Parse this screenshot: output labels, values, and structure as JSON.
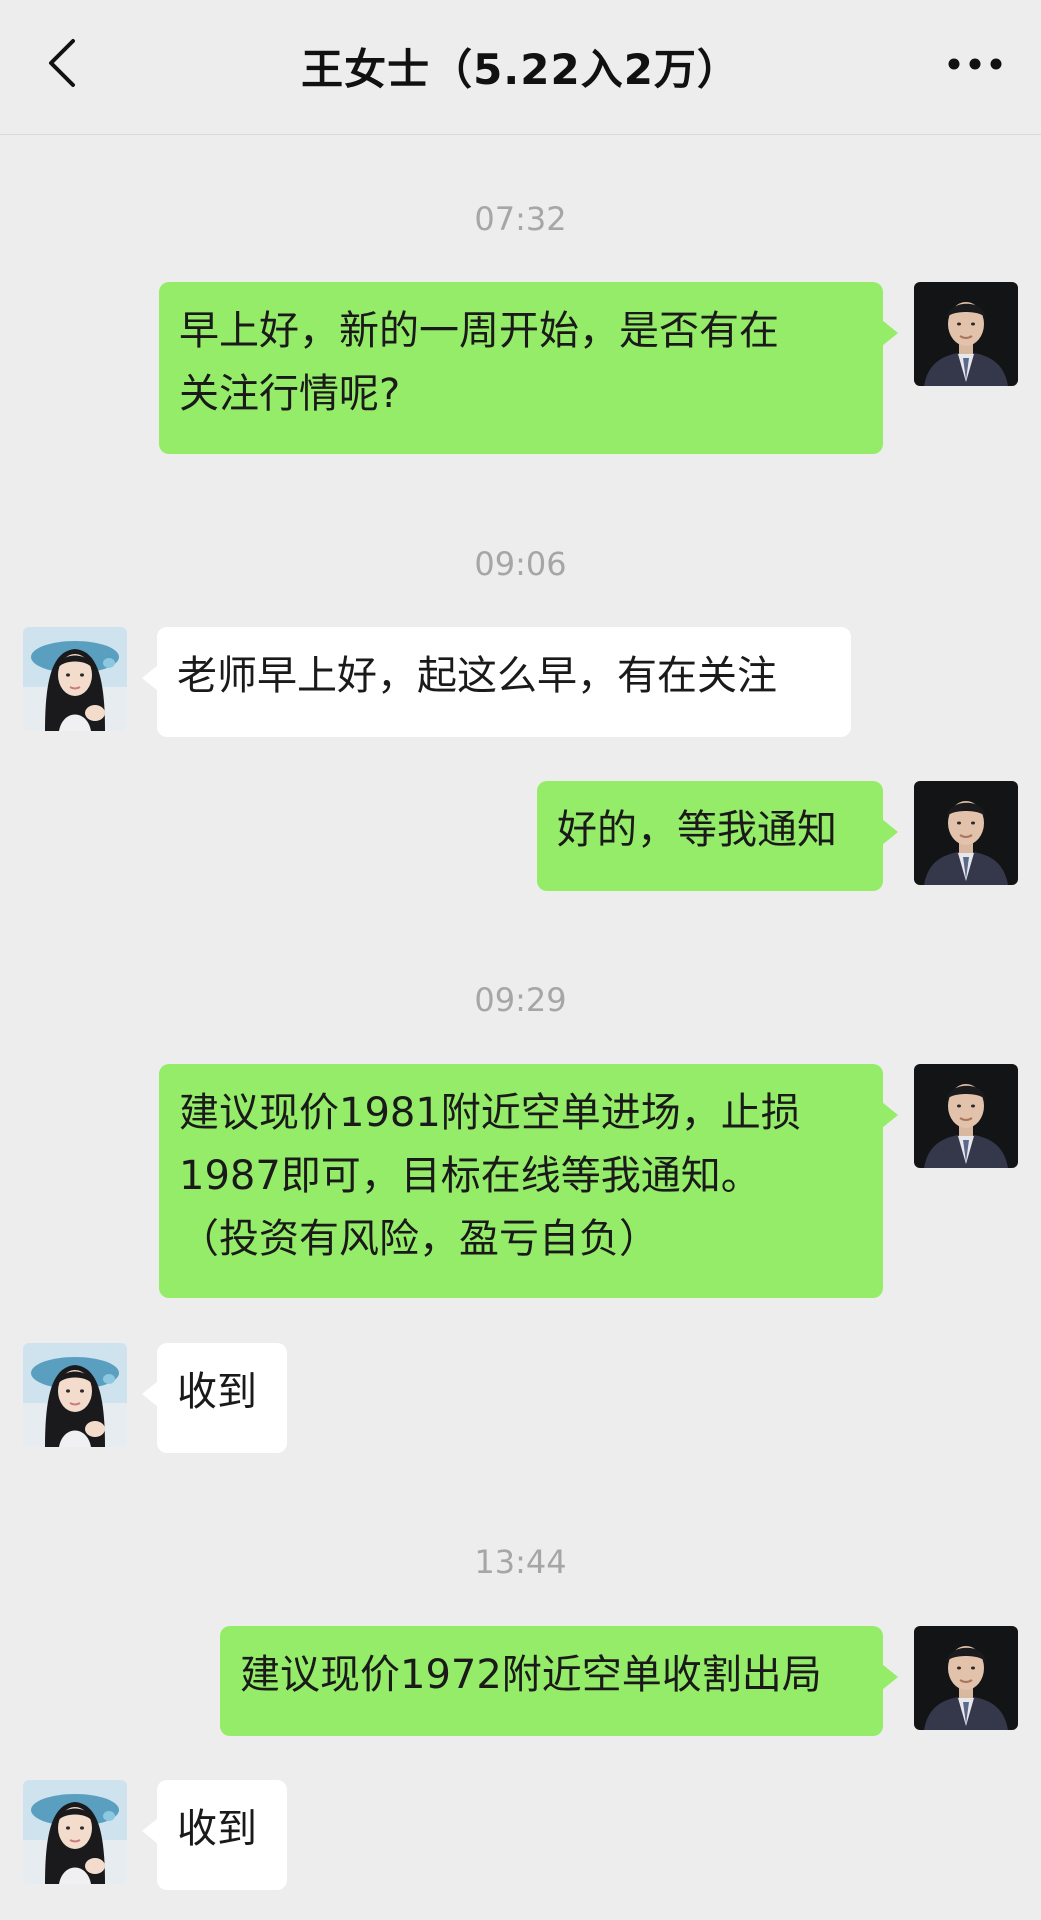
{
  "header": {
    "title": "王女士（5.22入2万）",
    "back_icon": "chevron-left-icon",
    "more_icon": "more-dots-icon"
  },
  "colors": {
    "sent_bubble": "#95ec69",
    "received_bubble": "#ffffff",
    "background": "#ededed",
    "timestamp": "#a6a6a6"
  },
  "messages": {
    "t1": "07:32",
    "m1": "早上好，新的一周开始，是否有在\n关注行情呢?",
    "t2": "09:06",
    "m2": "老师早上好，起这么早，有在关注",
    "m3": "好的，等我通知",
    "t3": "09:29",
    "m4": "建议现价1981附近空单进场，止损\n1987即可，目标在线等我通知。\n（投资有风险，盈亏自负）",
    "m5": "收到",
    "t4": "13:44",
    "m6": "建议现价1972附近空单收割出局",
    "m7": "收到"
  }
}
